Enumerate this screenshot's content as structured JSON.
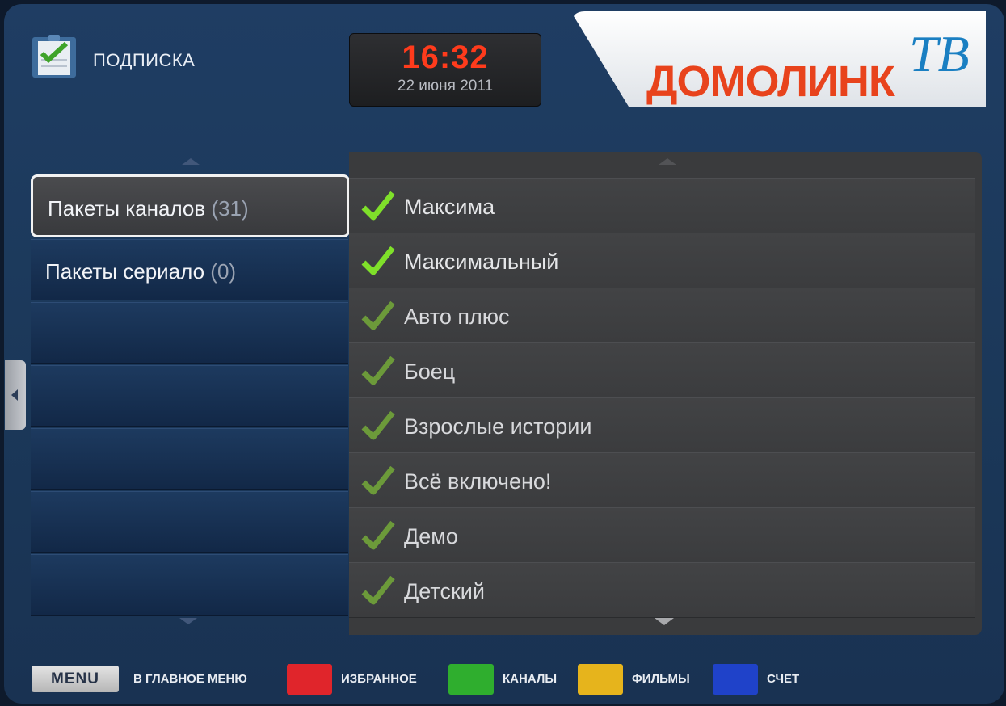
{
  "header": {
    "title": "ПОДПИСКА",
    "icon": "checklist-icon",
    "clock_time": "16:32",
    "clock_date": "22 июня 2011",
    "logo_text": "ДОМОЛИНК",
    "logo_tv": "ТВ"
  },
  "categories": [
    {
      "label": "Пакеты каналов",
      "count": "(31)",
      "selected": true
    },
    {
      "label": "Пакеты сериало",
      "count": "(0)",
      "selected": false
    }
  ],
  "packages": [
    {
      "name": "Максима",
      "check": "bright"
    },
    {
      "name": "Максимальный",
      "check": "bright"
    },
    {
      "name": "Авто плюс",
      "check": "dim"
    },
    {
      "name": "Боец",
      "check": "dim"
    },
    {
      "name": "Взрослые истории",
      "check": "dim"
    },
    {
      "name": "Всё включено!",
      "check": "dim"
    },
    {
      "name": "Демо",
      "check": "dim"
    },
    {
      "name": "Детский",
      "check": "dim"
    }
  ],
  "footer": {
    "menu_label": "MENU",
    "menu_action": "В ГЛАВНОЕ МЕНЮ",
    "red_label": "ИЗБРАННОЕ",
    "green_label": "КАНАЛЫ",
    "yellow_label": "ФИЛЬМЫ",
    "blue_label": "СЧЕТ"
  },
  "colors": {
    "red": "#e0252b",
    "green": "#2fae2e",
    "yellow": "#e6b41c",
    "blue": "#1f42c9",
    "clock": "#ff3b1c",
    "logo": "#e8431c",
    "check_bright": "#7fe02a",
    "check_dim": "#6c9a3a"
  }
}
